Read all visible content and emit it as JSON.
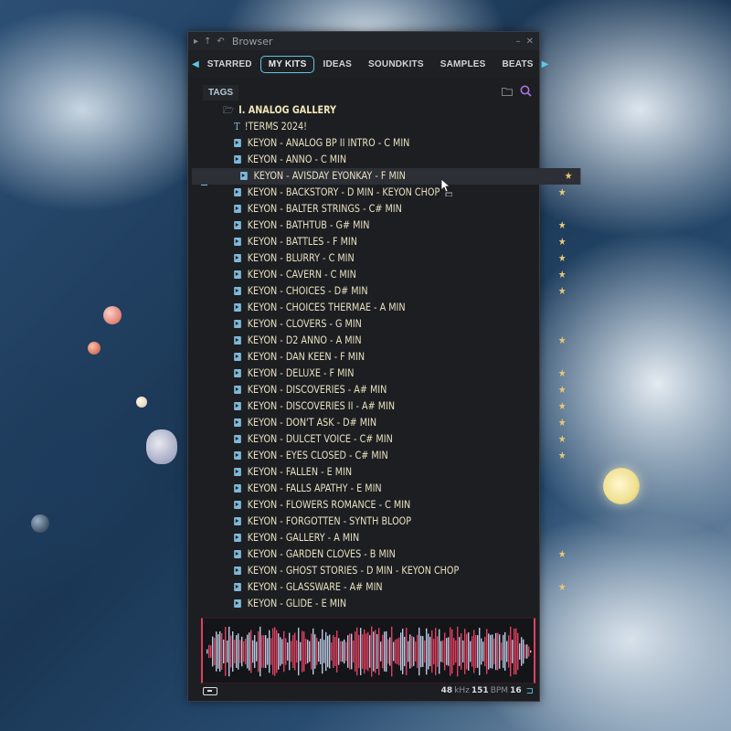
{
  "window": {
    "title": "Browser"
  },
  "tabs": [
    "STARRED",
    "MY KITS",
    "IDEAS",
    "SOUNDKITS",
    "SAMPLES",
    "BEATS"
  ],
  "active_tab": "MY KITS",
  "toolbar": {
    "tags_label": "TAGS"
  },
  "icons": {
    "folder": "folder-icon",
    "search": "search-icon",
    "sample": "play-sample-icon",
    "star": "star-icon"
  },
  "colors": {
    "accent": "#5ec8e8",
    "star": "#e8c878",
    "item_text": "#e8e0c0",
    "waveform_red": "#e04060",
    "waveform_blue": "#b8c8e0"
  },
  "folder": {
    "name": "I. ANALOG GALLERY"
  },
  "note_item": "!TERMS 2024!",
  "items": [
    {
      "label": "KEYON - ANALOG BP II INTRO - C MIN",
      "starred": false
    },
    {
      "label": "KEYON - ANNO - C MIN",
      "starred": false
    },
    {
      "label": "KEYON - AVISDAY EYONKAY - F MIN",
      "starred": true,
      "selected": true
    },
    {
      "label": "KEYON - BACKSTORY - D MIN - KEYON CHOP",
      "starred": true
    },
    {
      "label": "KEYON - BALTER STRINGS - C# MIN",
      "starred": false
    },
    {
      "label": "KEYON - BATHTUB - G# MIN",
      "starred": true
    },
    {
      "label": "KEYON - BATTLES - F MIN",
      "starred": true
    },
    {
      "label": "KEYON - BLURRY - C MIN",
      "starred": true
    },
    {
      "label": "KEYON - CAVERN - C MIN",
      "starred": true
    },
    {
      "label": "KEYON - CHOICES - D# MIN",
      "starred": true
    },
    {
      "label": "KEYON - CHOICES THERMAE - A MIN",
      "starred": false
    },
    {
      "label": "KEYON - CLOVERS - G MIN",
      "starred": false
    },
    {
      "label": "KEYON - D2 ANNO - A MIN",
      "starred": true
    },
    {
      "label": "KEYON - DAN KEEN - F MIN",
      "starred": false
    },
    {
      "label": "KEYON - DELUXE - F MIN",
      "starred": true
    },
    {
      "label": "KEYON - DISCOVERIES - A# MIN",
      "starred": true
    },
    {
      "label": "KEYON - DISCOVERIES II - A# MIN",
      "starred": true
    },
    {
      "label": "KEYON - DON'T ASK - D# MIN",
      "starred": true
    },
    {
      "label": "KEYON - DULCET VOICE - C# MIN",
      "starred": true
    },
    {
      "label": "KEYON - EYES CLOSED - C# MIN",
      "starred": true
    },
    {
      "label": "KEYON - FALLEN - E MIN",
      "starred": false
    },
    {
      "label": "KEYON - FALLS APATHY - E MIN",
      "starred": false
    },
    {
      "label": "KEYON - FLOWERS ROMANCE - C MIN",
      "starred": false
    },
    {
      "label": "KEYON - FORGOTTEN - SYNTH BLOOP",
      "starred": false
    },
    {
      "label": "KEYON - GALLERY - A MIN",
      "starred": false
    },
    {
      "label": "KEYON - GARDEN CLOVES - B MIN",
      "starred": true
    },
    {
      "label": "KEYON - GHOST STORIES - D MIN - KEYON CHOP",
      "starred": false
    },
    {
      "label": "KEYON - GLASSWARE - A# MIN",
      "starred": true
    },
    {
      "label": "KEYON - GLIDE - E MIN",
      "starred": false
    }
  ],
  "status": {
    "sample_rate": "48",
    "sample_rate_unit": "kHz",
    "bpm": "151",
    "bpm_unit": "BPM",
    "bits": "16"
  }
}
